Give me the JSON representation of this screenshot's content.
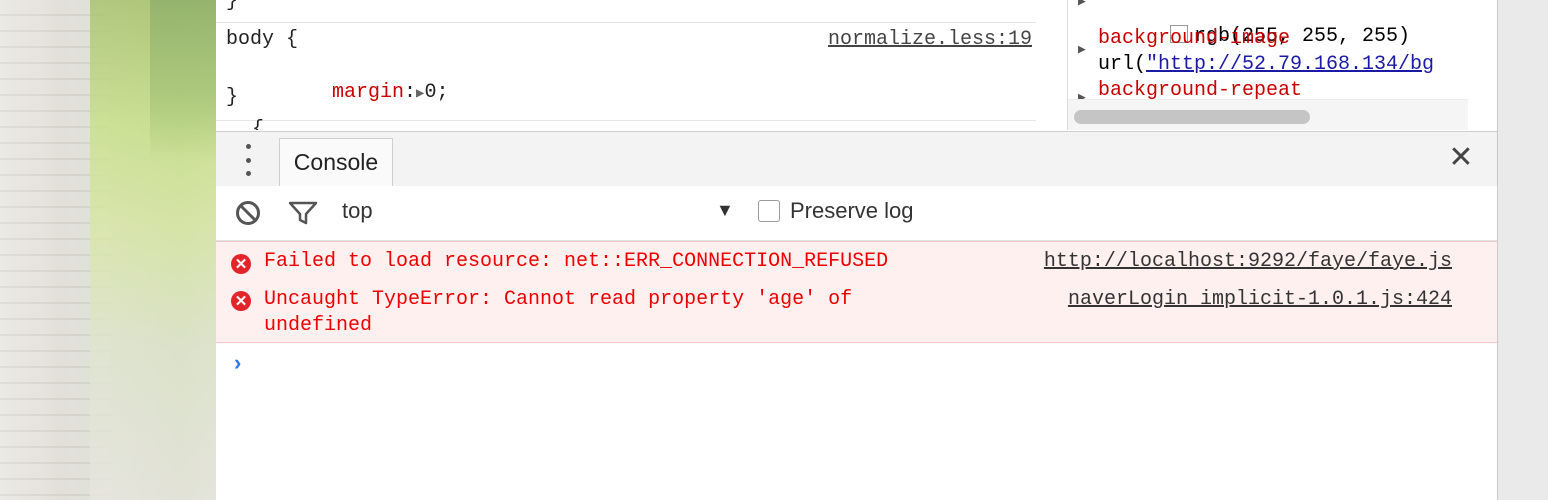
{
  "styles": {
    "closing_brace_top": "}",
    "rule_selector": "body {",
    "rule_property": "margin",
    "rule_colon": ":",
    "rule_triangle": "▶",
    "rule_value": "0;",
    "rule_close": "}",
    "rule_source": "normalize.less:19",
    "next_rule_partial": "{"
  },
  "computed": {
    "color_value": "rgb(255, 255, 255)",
    "background_image_label": "background-image",
    "url_prefix": "url(",
    "url_link": "\"http://52.79.168.134/bg",
    "background_repeat_label": "background-repeat"
  },
  "drawer": {
    "tab_console": "Console",
    "close_icon": "✕"
  },
  "toolbar": {
    "context": "top",
    "context_arrow": "▼",
    "preserve_log": "Preserve log"
  },
  "messages": [
    {
      "text": "Failed to load resource: net::ERR_CONNECTION_REFUSED",
      "source": "http://localhost:9292/faye/faye.js"
    },
    {
      "text": "Uncaught TypeError: Cannot read property 'age' of\nundefined",
      "source": "naverLogin_implicit-1.0.1.js:424"
    }
  ],
  "icons": {
    "error": "✕",
    "prompt": "›"
  },
  "colors": {
    "error_text": "#e00000",
    "error_bg": "#fff0f0",
    "property": "#c80000",
    "link": "#1a1aa6",
    "prompt": "#2b78e4"
  }
}
